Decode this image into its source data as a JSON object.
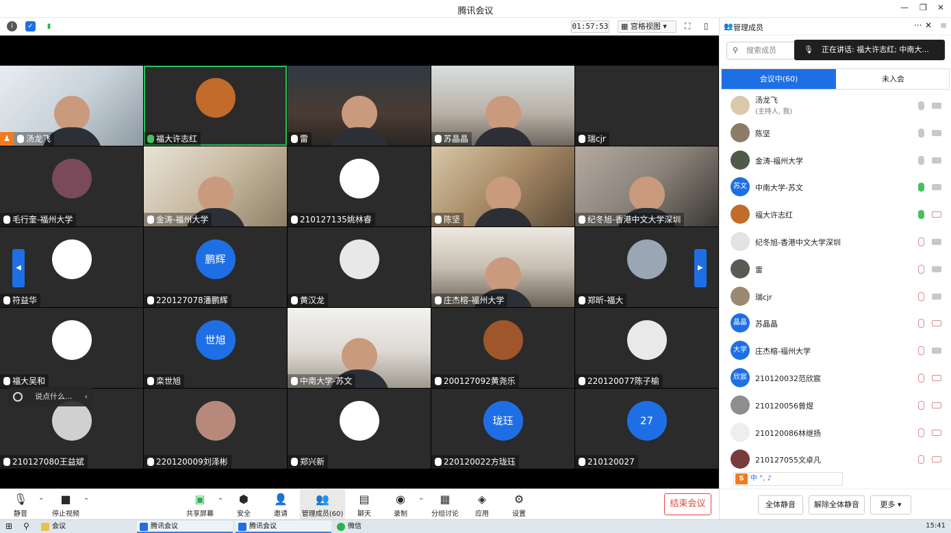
{
  "window": {
    "title": "腾讯会议"
  },
  "topbar": {
    "timer": "01:57:53",
    "view_mode": "宫格视图"
  },
  "tiles": [
    {
      "name": "汤龙飞",
      "cam": true,
      "host": true
    },
    {
      "name": "福大许志红",
      "cam": false,
      "avatar_color": "#c26b2a",
      "active": true
    },
    {
      "name": "雷",
      "cam": true
    },
    {
      "name": "苏晶晶",
      "cam": true
    },
    {
      "name": "瑞cjr",
      "cam": false,
      "avatar_color": ""
    },
    {
      "name": "毛行奎-福州大学",
      "cam": false,
      "avatar_color": "#7a4a5a"
    },
    {
      "name": "金涛-福州大学",
      "cam": true
    },
    {
      "name": "210127135姚林睿",
      "cam": false,
      "avatar_color": "#ffffff"
    },
    {
      "name": "陈坚",
      "cam": true
    },
    {
      "name": "纪冬旭-香港中文大学深圳",
      "cam": true
    },
    {
      "name": "符益华",
      "cam": false,
      "avatar_color": "#ffffff"
    },
    {
      "name": "220127078潘鹏辉",
      "cam": false,
      "avatar_color": "#1e6fe5",
      "avatar_text": "鹏辉"
    },
    {
      "name": "黄汉龙",
      "cam": false,
      "avatar_color": "#e8e8e8"
    },
    {
      "name": "庄杰榕-福州大学",
      "cam": true
    },
    {
      "name": "郑昕-福大",
      "cam": false,
      "avatar_color": "#9aa6b4"
    },
    {
      "name": "福大吴和",
      "cam": false,
      "avatar_color": "#ffffff"
    },
    {
      "name": "栾世旭",
      "cam": false,
      "avatar_color": "#1e6fe5",
      "avatar_text": "世旭"
    },
    {
      "name": "中南大学-苏文",
      "cam": true
    },
    {
      "name": "200127092黄尧乐",
      "cam": false,
      "avatar_color": "#a0562b"
    },
    {
      "name": "220120077陈子榆",
      "cam": false,
      "avatar_color": "#e9e9e9"
    },
    {
      "name": "210127080王益斌",
      "cam": false,
      "avatar_color": "#d0d0d0"
    },
    {
      "name": "220120009刘泽彬",
      "cam": false,
      "avatar_color": "#b7897a"
    },
    {
      "name": "郑兴新",
      "cam": false,
      "avatar_color": "#ffffff"
    },
    {
      "name": "220120022方珑珏",
      "cam": false,
      "avatar_color": "#1e6fe5",
      "avatar_text": "珑珏"
    },
    {
      "name": "210120027",
      "cam": false,
      "avatar_color": "#1e6fe5",
      "avatar_text": "27"
    }
  ],
  "chat_input": {
    "placeholder": "说点什么..."
  },
  "bottombar": {
    "mute": "静音",
    "stop_video": "停止视频",
    "share_screen": "共享屏幕",
    "security": "安全",
    "invite": "邀请",
    "manage_members": "管理成员(60)",
    "chat": "聊天",
    "record": "录制",
    "breakout": "分组讨论",
    "apps": "应用",
    "settings": "设置",
    "end_meeting": "结束会议"
  },
  "panel": {
    "title": "管理成员",
    "search_placeholder": "搜索成员",
    "speaking": "正在讲话: 福大许志红; 中南大...",
    "tab_in_meeting": "会议中(60)",
    "tab_not_joined": "未入会",
    "members": [
      {
        "name": "汤龙飞",
        "sub": "(主持人, 我)",
        "avatar_color": "#d9c9a8",
        "mic": "ok",
        "cam": "ok"
      },
      {
        "name": "陈坚",
        "avatar_color": "#8d7c68",
        "mic": "ok",
        "cam": "ok"
      },
      {
        "name": "金涛-福州大学",
        "avatar_color": "#4f5a48",
        "mic": "ok",
        "cam": "ok"
      },
      {
        "name": "中南大学-苏文",
        "avatar_color": "#1e6fe5",
        "avatar_text": "苏文",
        "mic": "green",
        "cam": "ok"
      },
      {
        "name": "福大许志红",
        "avatar_color": "#c26b2a",
        "mic": "green",
        "cam": "muted"
      },
      {
        "name": "纪冬旭-香港中文大学深圳",
        "avatar_color": "#e3e3e3",
        "mic": "muted",
        "cam": "ok"
      },
      {
        "name": "雷",
        "avatar_color": "#5a5a55",
        "mic": "muted",
        "cam": "ok"
      },
      {
        "name": "瑞cjr",
        "avatar_color": "#9a8a70",
        "mic": "muted",
        "cam": "ok"
      },
      {
        "name": "苏晶晶",
        "avatar_color": "#1e6fe5",
        "avatar_text": "晶晶",
        "mic": "muted",
        "cam": "muted"
      },
      {
        "name": "庄杰榕-福州大学",
        "avatar_color": "#1e6fe5",
        "avatar_text": "大学",
        "mic": "muted",
        "cam": "ok"
      },
      {
        "name": "210120032范欣宸",
        "avatar_color": "#1e6fe5",
        "avatar_text": "欣宸",
        "mic": "muted",
        "cam": "muted"
      },
      {
        "name": "210120056曾煜",
        "avatar_color": "#8e8e8e",
        "mic": "muted",
        "cam": "muted"
      },
      {
        "name": "210120086林继扬",
        "avatar_color": "#eeeeee",
        "mic": "muted",
        "cam": "muted"
      },
      {
        "name": "210127055文卓凡",
        "avatar_color": "#7a3b3b",
        "mic": "muted",
        "cam": "muted"
      }
    ],
    "mute_all": "全体静音",
    "unmute_all": "解除全体静音",
    "more": "更多"
  },
  "ime": {
    "label": "中 °, ♪"
  },
  "taskbar": {
    "items": [
      "会议",
      "腾讯会议",
      "腾讯会议",
      "微信"
    ],
    "clock": "15:41"
  }
}
